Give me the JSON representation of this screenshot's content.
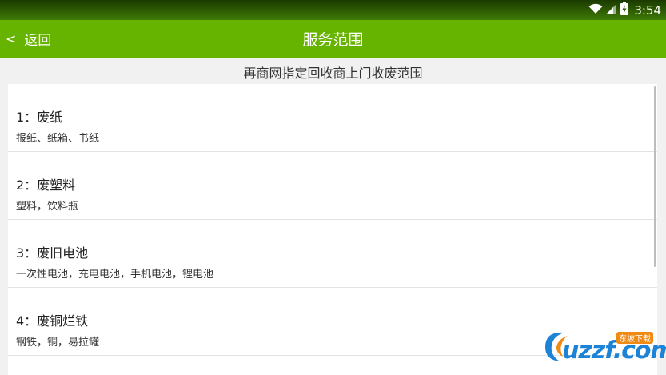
{
  "status_bar": {
    "time": "3:54"
  },
  "header": {
    "back_label": "返回",
    "back_chevron": "<",
    "title": "服务范围"
  },
  "subtitle": "再商网指定回收商上门收废范围",
  "items": [
    {
      "title": "1：废纸",
      "desc": "报纸、纸箱、书纸"
    },
    {
      "title": "2：废塑料",
      "desc": "塑料，饮料瓶"
    },
    {
      "title": "3：废旧电池",
      "desc": "一次性电池，充电电池，手机电池，锂电池"
    },
    {
      "title": "4：废铜烂铁",
      "desc": "钢铁，铜，易拉罐"
    }
  ],
  "watermark": {
    "logo_text": "uzzf.com",
    "badge_text": "东坡下载"
  },
  "colors": {
    "header": "#67b400",
    "status_bar": "#2a5a02",
    "background": "#f1f1f1",
    "watermark": "#1d83d6"
  }
}
